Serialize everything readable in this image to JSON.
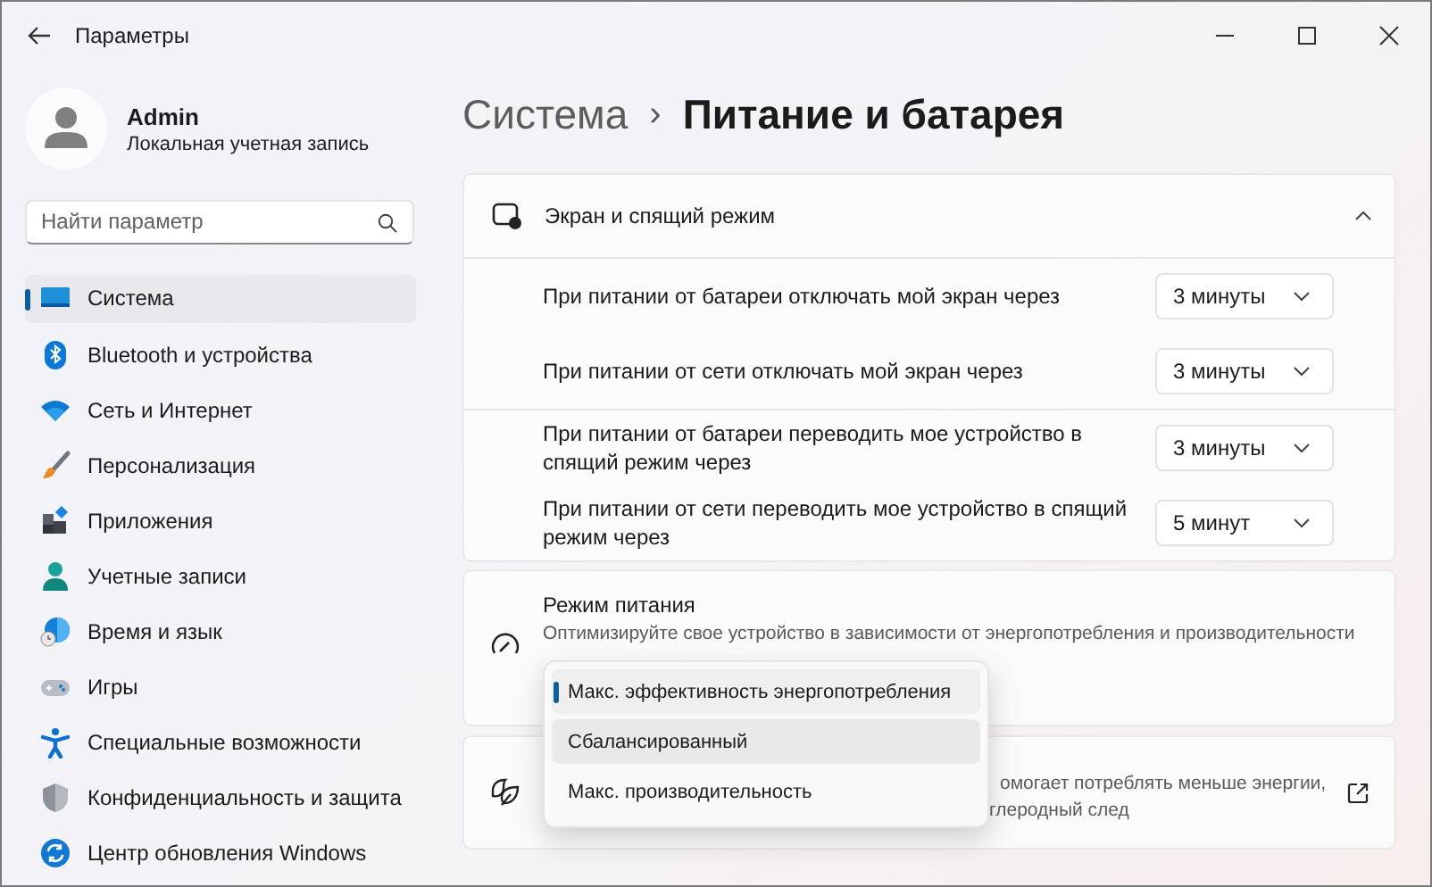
{
  "window": {
    "title": "Параметры"
  },
  "user": {
    "name": "Admin",
    "account": "Локальная учетная запись"
  },
  "search": {
    "placeholder": "Найти параметр"
  },
  "sidebar": {
    "items": [
      {
        "label": "Система",
        "selected": true
      },
      {
        "label": "Bluetooth и устройства",
        "selected": false
      },
      {
        "label": "Сеть и Интернет",
        "selected": false
      },
      {
        "label": "Персонализация",
        "selected": false
      },
      {
        "label": "Приложения",
        "selected": false
      },
      {
        "label": "Учетные записи",
        "selected": false
      },
      {
        "label": "Время и язык",
        "selected": false
      },
      {
        "label": "Игры",
        "selected": false
      },
      {
        "label": "Специальные возможности",
        "selected": false
      },
      {
        "label": "Конфиденциальность и защита",
        "selected": false
      },
      {
        "label": "Центр обновления Windows",
        "selected": false
      }
    ]
  },
  "breadcrumb": {
    "parent": "Система",
    "separator": "›",
    "current": "Питание и батарея"
  },
  "screen_sleep": {
    "title": "Экран и спящий режим",
    "expanded": true,
    "groups": [
      {
        "settings": [
          {
            "label": "При питании от батареи отключать мой экран через",
            "value": "3 минуты"
          },
          {
            "label": "При питании от сети отключать мой экран через",
            "value": "3 минуты"
          }
        ]
      },
      {
        "settings": [
          {
            "label": "При питании от батареи переводить мое устройство в спящий режим через",
            "value": "3 минуты"
          },
          {
            "label": "При питании от сети переводить мое устройство в спящий режим через",
            "value": "5 минут"
          }
        ]
      }
    ]
  },
  "power_mode": {
    "title": "Режим питания",
    "description": "Оптимизируйте свое устройство в зависимости от энергопотребления и производительности",
    "options": [
      {
        "label": "Макс. эффективность энергопотребления",
        "selected": true,
        "hovered": false
      },
      {
        "label": "Сбалансированный",
        "selected": false,
        "hovered": true
      },
      {
        "label": "Макс. производительность",
        "selected": false,
        "hovered": false
      }
    ]
  },
  "energy_card": {
    "description_lines": [
      "омогает потреблять меньше энергии,",
      "глеродный след"
    ]
  }
}
